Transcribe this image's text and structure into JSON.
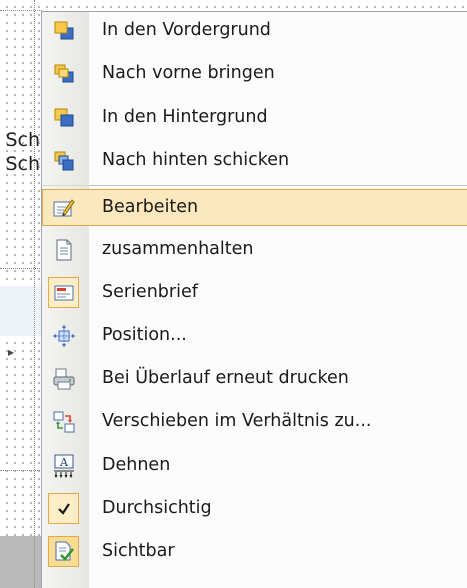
{
  "context_menu": {
    "items": [
      {
        "label": "In  den  Vordergrund",
        "icon": "bring-to-front-icon",
        "checked": false
      },
      {
        "label": "Nach vorne bringen",
        "icon": "bring-forward-icon",
        "checked": false
      },
      {
        "label": "In den Hintergrund",
        "icon": "send-to-back-icon",
        "checked": false
      },
      {
        "label": "Nach hinten schicken",
        "icon": "send-backward-icon",
        "checked": false
      },
      {
        "label": "Bearbeiten",
        "icon": "edit-icon",
        "checked": false,
        "highlighted": true
      },
      {
        "label": "zusammenhalten",
        "icon": "document-icon",
        "checked": false
      },
      {
        "label": "Serienbrief",
        "icon": "mail-merge-icon",
        "checked": true
      },
      {
        "label": "Position...",
        "icon": "position-icon",
        "checked": false
      },
      {
        "label": "Bei Überlauf erneut drucken",
        "icon": "reprint-on-overflow-icon",
        "checked": false
      },
      {
        "label": "Verschieben im Verhältnis zu...",
        "icon": "move-relative-icon",
        "checked": false
      },
      {
        "label": "Dehnen",
        "icon": "stretch-icon",
        "checked": false
      },
      {
        "label": "Durchsichtig",
        "icon": "checkmark-icon",
        "checked": true
      },
      {
        "label": "Sichtbar",
        "icon": "visible-icon",
        "checked": true
      }
    ]
  },
  "background": {
    "text_fragment_1": "Sch",
    "text_fragment_2": "Sch"
  },
  "colors": {
    "highlight_fill": "#fde8bd",
    "highlight_border": "#e4a94a",
    "menu_background": "#fcfcfc"
  }
}
